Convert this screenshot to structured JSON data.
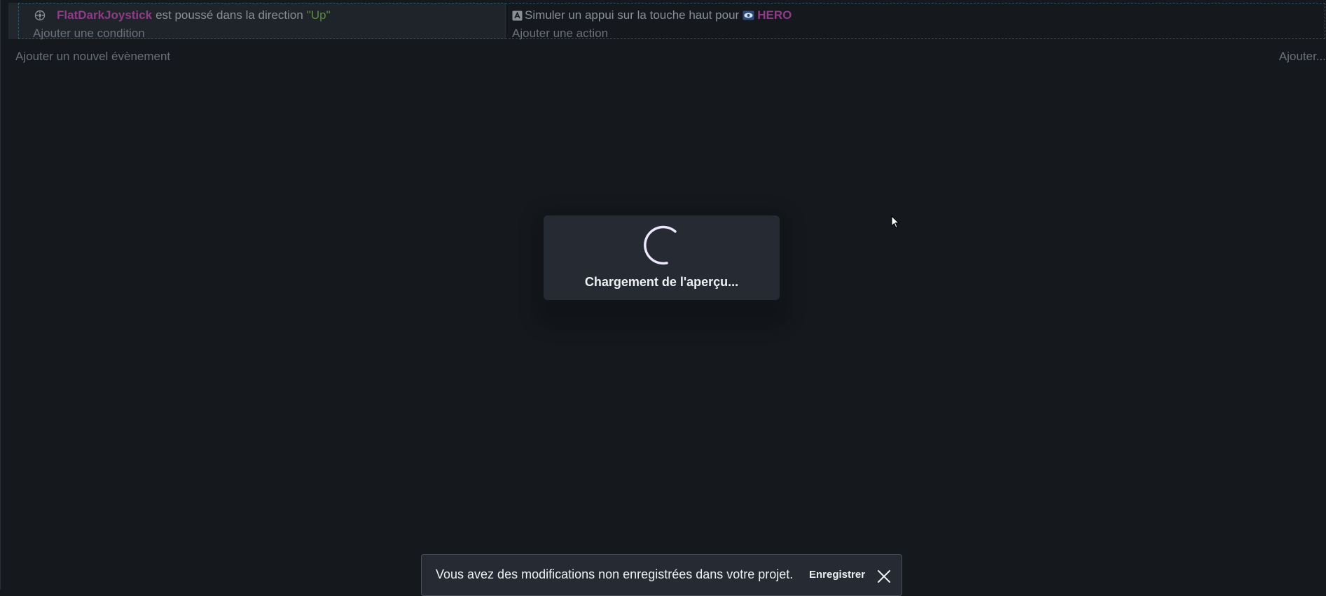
{
  "event": {
    "condition": {
      "object_name": "FlatDarkJoystick",
      "text": "est poussé dans la direction",
      "param": "\"Up\""
    },
    "add_condition_label": "Ajouter une condition",
    "action": {
      "text": "Simuler un appui sur la touche haut pour",
      "object_name": "HERO"
    },
    "add_action_label": "Ajouter une action"
  },
  "add_event_label": "Ajouter un nouvel évènement",
  "add_other_label": "Ajouter...",
  "loading": {
    "text": "Chargement de l'aperçu..."
  },
  "snackbar": {
    "message": "Vous avez des modifications non enregistrées dans votre projet.",
    "save_label": "Enregistrer"
  },
  "colors": {
    "background": "#15181d",
    "object_name": "#8c3d86",
    "param": "#5e8a43",
    "muted_text": "#6b7079"
  },
  "icons": {
    "condition": "joystick-icon",
    "action": "keyboard-icon",
    "object": "sprite-eye-icon",
    "close": "close-icon"
  }
}
